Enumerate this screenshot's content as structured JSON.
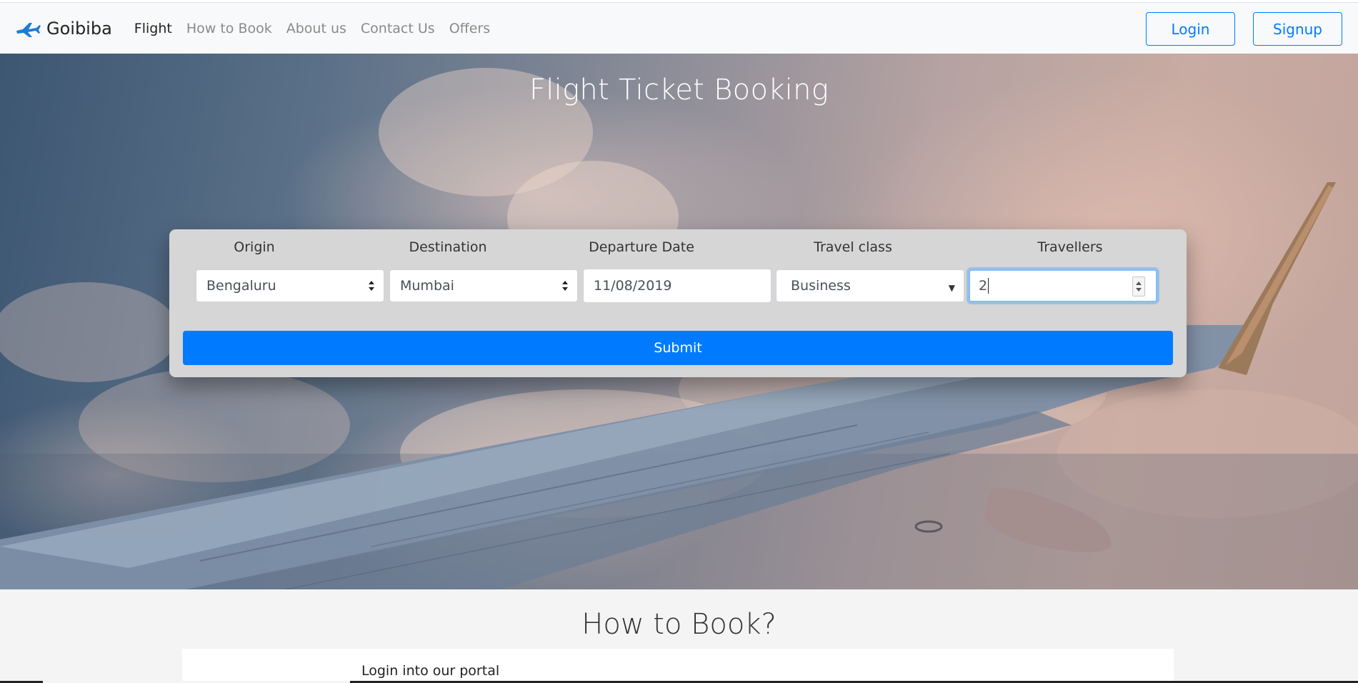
{
  "nav": {
    "brand": "Goibiba",
    "links": [
      {
        "label": "Flight",
        "active": true
      },
      {
        "label": "How to Book",
        "active": false
      },
      {
        "label": "About us",
        "active": false
      },
      {
        "label": "Contact Us",
        "active": false
      },
      {
        "label": "Offers",
        "active": false
      }
    ],
    "login_label": "Login",
    "signup_label": "Signup"
  },
  "hero": {
    "title": "Flight Ticket Booking"
  },
  "form": {
    "origin": {
      "label": "Origin",
      "value": "Bengaluru"
    },
    "destination": {
      "label": "Destination",
      "value": "Mumbai"
    },
    "departure": {
      "label": "Departure Date",
      "value": "11/08/2019"
    },
    "travel_class": {
      "label": "Travel class",
      "value": "Business"
    },
    "travellers": {
      "label": "Travellers",
      "value": "2"
    },
    "submit_label": "Submit"
  },
  "howto": {
    "title": "How to Book?",
    "steps": [
      "Login into our portal"
    ]
  },
  "colors": {
    "primary": "#007bff",
    "navbar_bg": "#f8f9fa",
    "card_bg": "#d6d6d6"
  },
  "icons": {
    "brand": "airplane-icon",
    "select": "sort-arrows-icon",
    "dropdown": "caret-down-icon",
    "number": "spinner-icon"
  }
}
